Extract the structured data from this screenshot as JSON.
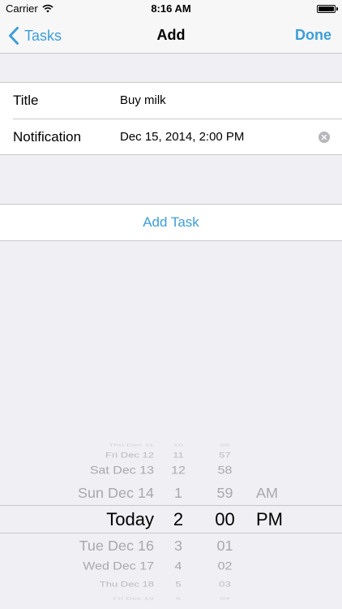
{
  "status_bar": {
    "carrier": "Carrier",
    "time": "8:16 AM"
  },
  "nav": {
    "back_label": "Tasks",
    "title": "Add",
    "done_label": "Done"
  },
  "form": {
    "title_label": "Title",
    "title_value": "Buy milk",
    "notification_label": "Notification",
    "notification_value": "Dec 15, 2014, 2:00 PM"
  },
  "add_task_label": "Add Task",
  "picker": {
    "dates": [
      "Thu Dec 11",
      "Fri Dec 12",
      "Sat Dec 13",
      "Sun Dec 14",
      "Today",
      "Tue Dec 16",
      "Wed Dec 17",
      "Thu Dec 18",
      "Fri Dec 19"
    ],
    "hours": [
      "10",
      "11",
      "12",
      "1",
      "2",
      "3",
      "4",
      "5",
      "6"
    ],
    "minutes": [
      "56",
      "57",
      "58",
      "59",
      "00",
      "01",
      "02",
      "03",
      "04"
    ],
    "ampm": [
      "AM",
      "PM"
    ],
    "selected_index": 4
  },
  "colors": {
    "accent": "#3d9ed9",
    "background": "#efeff4",
    "separator": "#c8c7cc",
    "picker_inactive": "#a8a8ad"
  }
}
